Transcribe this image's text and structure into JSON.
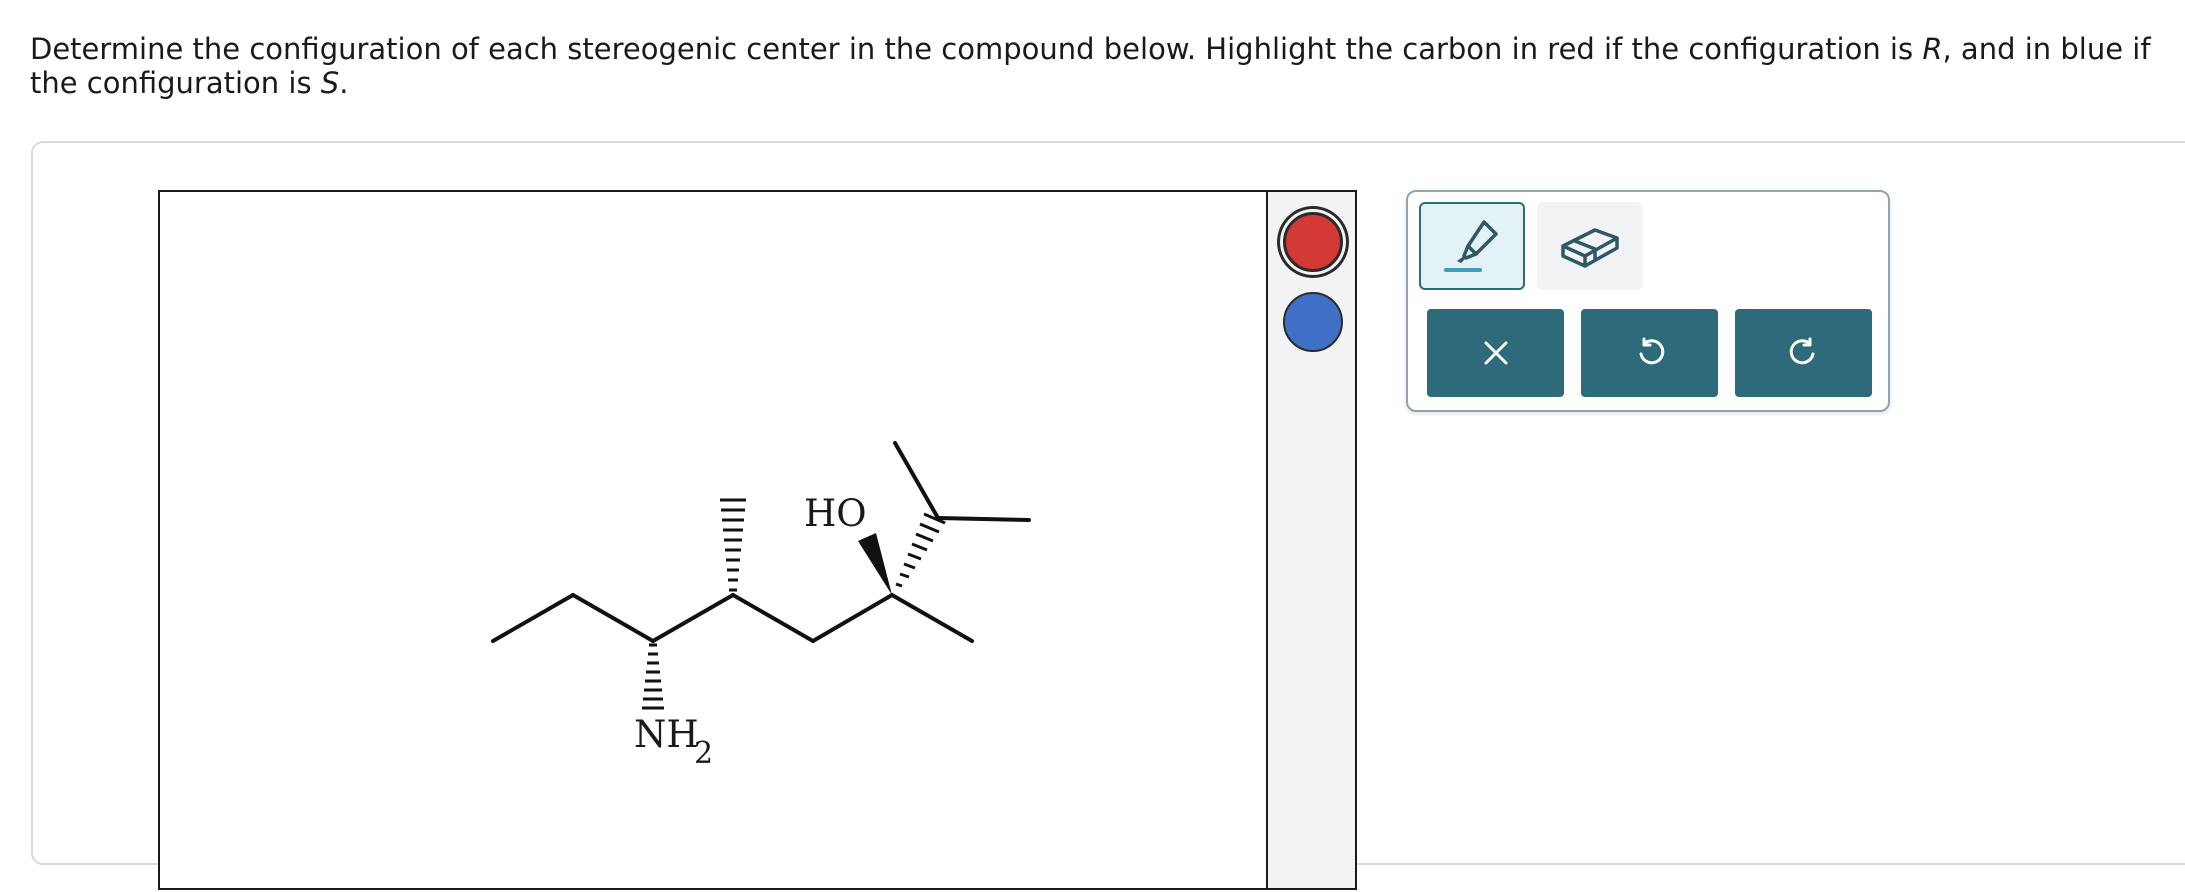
{
  "question": {
    "text_before_r": "Determine the configuration of each stereogenic center in the compound below. Highlight the carbon in red if the configuration is ",
    "r_letter": "R",
    "text_between": ", and in blue if the configuration is ",
    "s_letter": "S",
    "text_end": "."
  },
  "molecule": {
    "labels": {
      "hydroxyl": "HO",
      "amine_n": "NH",
      "amine_sub": "2"
    }
  },
  "palette": {
    "colors": {
      "red": "#d33a36",
      "blue": "#4070c6"
    },
    "selected": "red"
  },
  "tools": {
    "pen_icon": "highlighter-pen-icon",
    "eraser_icon": "eraser-icon",
    "selected": "pen"
  },
  "actions": {
    "clear_icon": "close-icon",
    "undo_icon": "undo-icon",
    "redo_icon": "redo-icon"
  }
}
